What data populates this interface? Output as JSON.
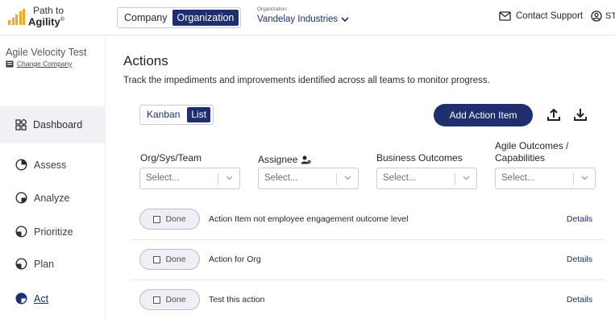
{
  "header": {
    "logo_line1": "Path to",
    "logo_line2": "Agility",
    "logo_mark": "®",
    "scope_tabs": [
      "Company",
      "Organization"
    ],
    "active_scope": "Organization",
    "org_label": "Organization",
    "org_value": "Vandelay Industries",
    "contact_support": "Contact Support",
    "user_initials": "ST"
  },
  "sidebar": {
    "company_name": "Agile Velocity Test",
    "change_company": "Change Company",
    "items": [
      {
        "label": "Dashboard",
        "icon": "dashboard-icon"
      },
      {
        "label": "Assess",
        "icon": "assess-icon"
      },
      {
        "label": "Analyze",
        "icon": "analyze-icon"
      },
      {
        "label": "Prioritize",
        "icon": "prioritize-icon"
      },
      {
        "label": "Plan",
        "icon": "plan-icon"
      },
      {
        "label": "Act",
        "icon": "act-icon",
        "active": true
      }
    ]
  },
  "main": {
    "title": "Actions",
    "subtitle": "Track the impediments and improvements identified across all teams to monitor progress.",
    "view_tabs": [
      "Kanban",
      "List"
    ],
    "active_view": "List",
    "add_button": "Add Action Item",
    "filters": [
      {
        "label": "Org/Sys/Team",
        "placeholder": "Select..."
      },
      {
        "label": "Assignee",
        "placeholder": "Select..."
      },
      {
        "label": "Business Outcomes",
        "placeholder": "Select..."
      },
      {
        "label": "Agile Outcomes / Capabilities",
        "placeholder": "Select..."
      }
    ],
    "actions": [
      {
        "done_label": "Done",
        "title": "Action Item not employee engagement outcome level",
        "details": "Details"
      },
      {
        "done_label": "Done",
        "title": "Action for Org",
        "details": "Details"
      },
      {
        "done_label": "Done",
        "title": "Test this action",
        "details": "Details"
      }
    ]
  },
  "colors": {
    "brand_navy": "#1e2e6e",
    "logo_orange": "#f2a72b"
  }
}
